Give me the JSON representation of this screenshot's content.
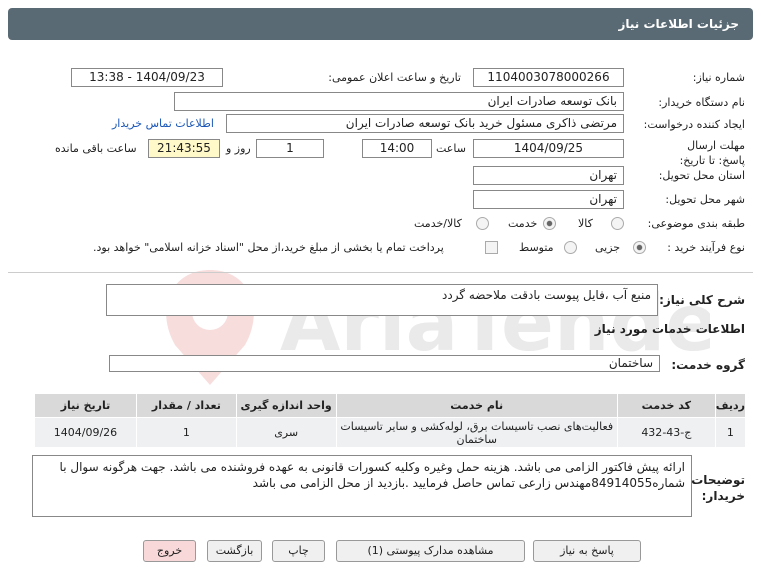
{
  "title": "جزئیات اطلاعات نیاز",
  "need_number": {
    "label": "شماره نیاز:",
    "value": "1104003078000266"
  },
  "announce": {
    "label": "تاریخ و ساعت اعلان عمومی:",
    "value": "1404/09/23 - 13:38"
  },
  "buyer": {
    "label": "نام دستگاه خریدار:",
    "value": "بانک توسعه صادرات ایران"
  },
  "creator": {
    "label": "ایجاد کننده درخواست:",
    "value": "مرتضی ذاکری مسئول خرید بانک توسعه صادرات ایران",
    "contact_link": "اطلاعات تماس خریدار"
  },
  "deadline": {
    "label": "مهلت ارسال پاسخ: تا تاریخ:",
    "date": "1404/09/25",
    "time_label": "ساعت",
    "time": "14:00",
    "days": "1",
    "days_label": "روز و",
    "remaining": "21:43:55",
    "remaining_label": "ساعت باقی مانده"
  },
  "province": {
    "label": "استان محل تحویل:",
    "value": "تهران"
  },
  "city": {
    "label": "شهر محل تحویل:",
    "value": "تهران"
  },
  "category": {
    "label": "طبقه بندی موضوعی:",
    "options": [
      "کالا",
      "خدمت",
      "کالا/خدمت"
    ],
    "selected": "خدمت"
  },
  "process": {
    "label": "نوع فرآیند خرید :",
    "options": [
      "جزیی",
      "متوسط"
    ],
    "selected": "جزیی",
    "note": "پرداخت تمام یا بخشی از مبلغ خرید،از محل \"اسناد خزانه اسلامی\" خواهد بود."
  },
  "summary": {
    "label": "شرح کلی نیاز:",
    "value": "منبع آب ،فایل پیوست بادقت ملاحضه گردد"
  },
  "services_title": "اطلاعات خدمات مورد نیاز",
  "service_group": {
    "label": "گروه خدمت:",
    "value": "ساختمان"
  },
  "table": {
    "headers": [
      "ردیف",
      "کد خدمت",
      "نام خدمت",
      "واحد اندازه گیری",
      "تعداد / مقدار",
      "تاریخ نیاز"
    ],
    "rows": [
      [
        "1",
        "ج-43-432",
        "فعالیت‌های نصب تاسیسات برق، لوله‌کشی و سایر تاسیسات ساختمان",
        "سری",
        "1",
        "1404/09/26"
      ]
    ]
  },
  "notes": {
    "label": "توضیحات خریدار:",
    "value": "ارائه پیش فاکتور الزامی می باشد. هزینه حمل وغیره وکلیه کسورات قانونی به عهده فروشنده می باشد. جهت هرگونه سوال با شماره84914055مهندس زارعی تماس حاصل فرمایید .بازدید از محل الزامی می باشد"
  },
  "buttons": {
    "reply": "پاسخ به نیاز",
    "docs": "مشاهده مدارک پیوستی (1)",
    "print": "چاپ",
    "back": "بازگشت",
    "exit": "خروج"
  },
  "watermark_text": "AriaTender.net",
  "colors": {
    "title_bg": "#5a6a74",
    "remaining_bg": "#fff8c8",
    "exit_bg": "#f8d8d8",
    "table_header": "#d9d9d9"
  }
}
